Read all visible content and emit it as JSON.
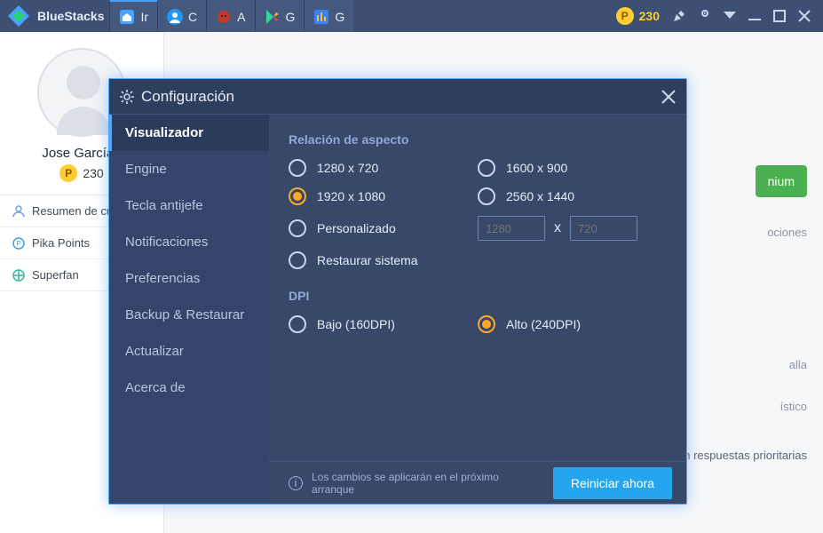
{
  "app": {
    "name": "BlueStacks"
  },
  "tabs": [
    {
      "label": "Ir"
    },
    {
      "label": "C"
    },
    {
      "label": "A"
    },
    {
      "label": "G"
    },
    {
      "label": "G"
    }
  ],
  "coins": "230",
  "account": {
    "name": "Jose García I",
    "coins": "230",
    "items": [
      {
        "label": "Resumen de cuenta"
      },
      {
        "label": "Pika Points"
      },
      {
        "label": "Superfan"
      }
    ]
  },
  "bg": {
    "premium": "nium",
    "options_frag": "ociones",
    "screen_frag": "alla",
    "stat_frag": "ístico",
    "priority": "Obtén respuestas prioritarias"
  },
  "dialog": {
    "title": "Configuración",
    "sidebar": [
      "Visualizador",
      "Engine",
      "Tecla antijefe",
      "Notificaciones",
      "Preferencias",
      "Backup & Restaurar",
      "Actualizar",
      "Acerca de"
    ],
    "aspect": {
      "title": "Relación de aspecto",
      "r1": "1280 x 720",
      "r2": "1600 x 900",
      "r3": "1920 x 1080",
      "r4": "2560 x 1440",
      "custom": "Personalizado",
      "w_ph": "1280",
      "h_ph": "720",
      "x": "x",
      "restore": "Restaurar sistema"
    },
    "dpi": {
      "title": "DPI",
      "low": "Bajo (160DPI)",
      "high": "Alto (240DPI)"
    },
    "footer": {
      "note": "Los cambios se aplicarán en el próximo arranque",
      "button": "Reiniciar ahora"
    }
  }
}
